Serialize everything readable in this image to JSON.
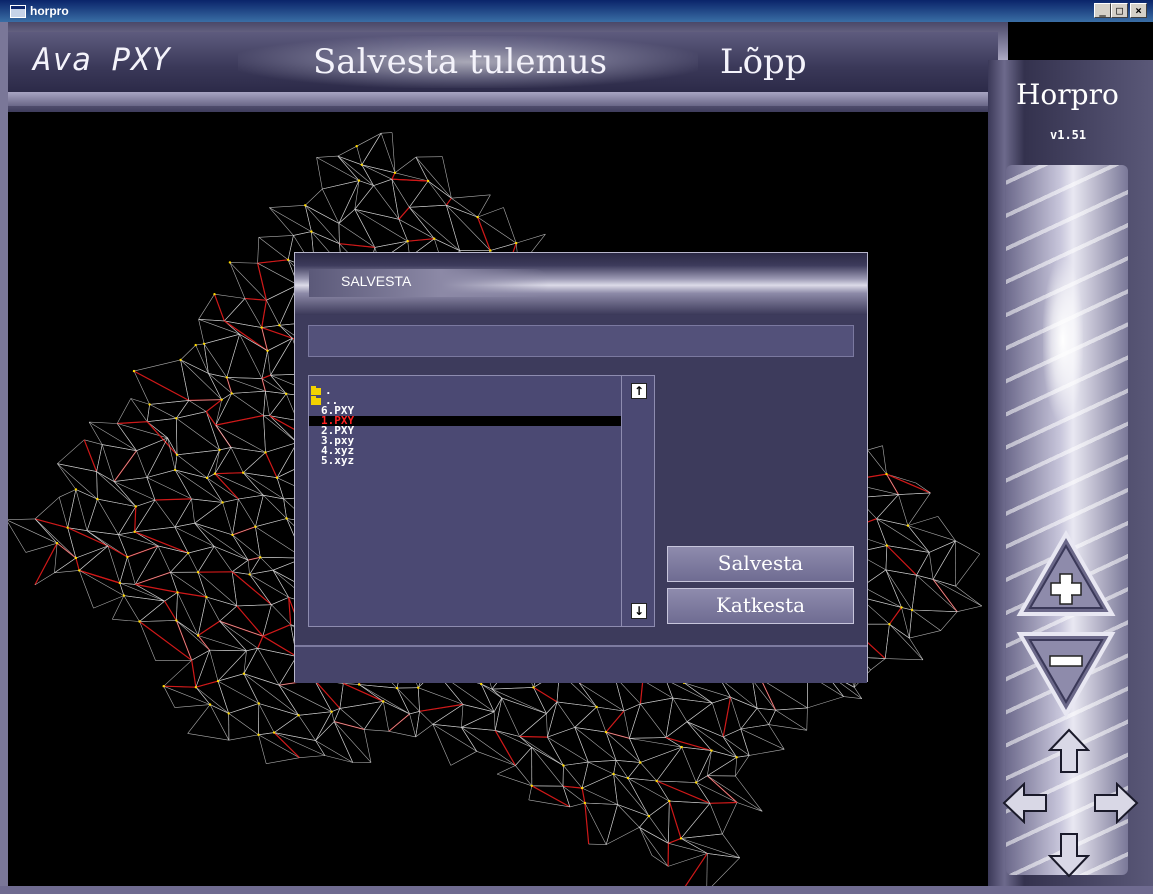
{
  "window": {
    "title": "horpro"
  },
  "menu": {
    "open_label": "Ava  PXY",
    "save_label": "Salvesta tulemus",
    "end_label": "Lõpp"
  },
  "sidebar": {
    "brand": "Horpro",
    "version": "v1.51"
  },
  "dialog": {
    "title": "SALVESTA",
    "filename_value": "",
    "files": [
      {
        "name": ".",
        "type": "folder",
        "selected": false
      },
      {
        "name": "..",
        "type": "folder",
        "selected": false
      },
      {
        "name": "6.PXY",
        "type": "file",
        "selected": false
      },
      {
        "name": "1.PXY",
        "type": "file",
        "selected": true
      },
      {
        "name": "2.PXY",
        "type": "file",
        "selected": false
      },
      {
        "name": "3.pxy",
        "type": "file",
        "selected": false
      },
      {
        "name": "4.xyz",
        "type": "file",
        "selected": false
      },
      {
        "name": "5.xyz",
        "type": "file",
        "selected": false
      }
    ],
    "save_button": "Salvesta",
    "cancel_button": "Katkesta",
    "status_text": ""
  },
  "colors": {
    "background": "#000000",
    "mesh_line": "#d8d8d8",
    "mesh_edge": "#d01818",
    "mesh_node": "#ffd800",
    "dialog_bg": "#3d3b5c",
    "selected_text": "#ff2020"
  },
  "icons": {
    "scroll_up": "arrow-up-icon",
    "scroll_down": "arrow-down-icon",
    "zoom_in": "plus-icon",
    "zoom_out": "minus-icon",
    "pan_up": "pan-up-icon",
    "pan_left": "pan-left-icon",
    "pan_right": "pan-right-icon",
    "pan_down": "pan-down-icon"
  }
}
